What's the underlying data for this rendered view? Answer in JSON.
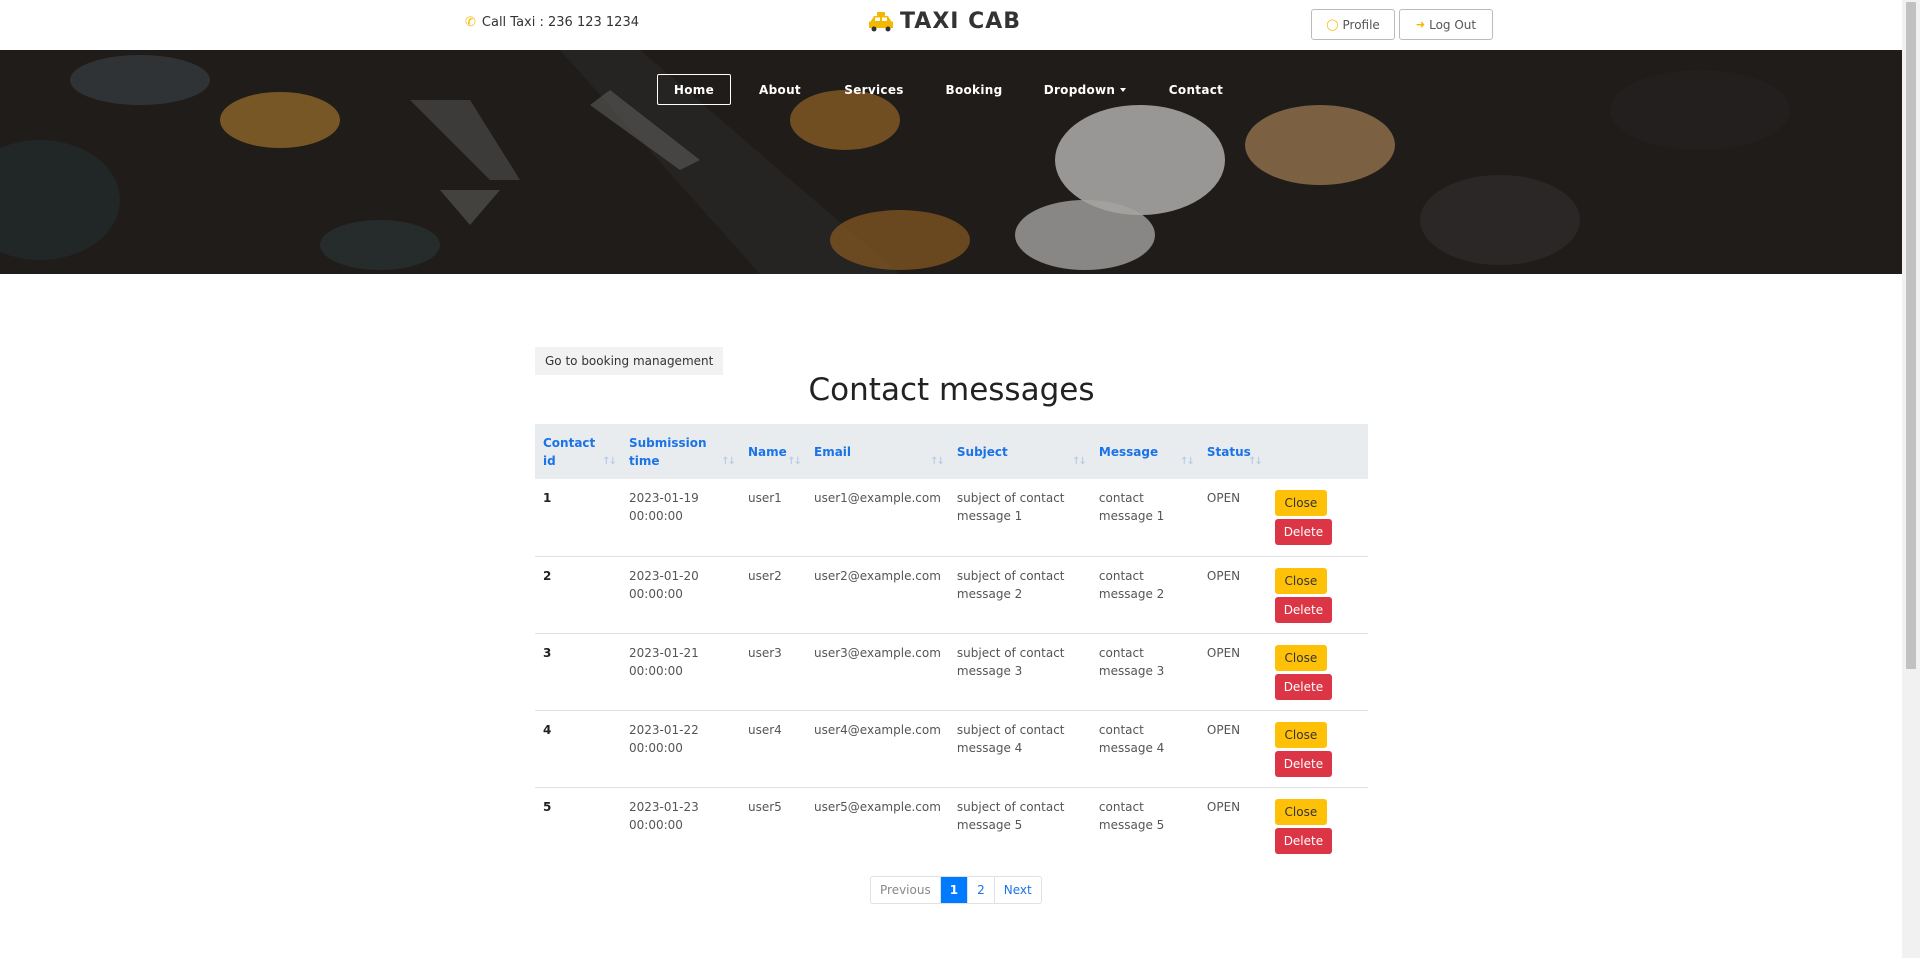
{
  "header": {
    "call_text": "Call Taxi : 236 123 1234",
    "brand": "TAXI CAB",
    "profile_label": "Profile",
    "logout_label": "Log Out",
    "accent_color": "#f5b800"
  },
  "nav": {
    "items": [
      {
        "label": "Home",
        "active": true
      },
      {
        "label": "About"
      },
      {
        "label": "Services"
      },
      {
        "label": "Booking"
      },
      {
        "label": "Dropdown"
      },
      {
        "label": "Contact"
      }
    ]
  },
  "main": {
    "go_button": "Go to booking management",
    "title": "Contact messages",
    "columns": [
      "Contact id",
      "Submission time",
      "Name",
      "Email",
      "Subject",
      "Message",
      "Status"
    ],
    "rows": [
      {
        "id": "1",
        "time": "2023-01-19 00:00:00",
        "name": "user1",
        "email": "user1@example.com",
        "subject": "subject of contact message 1",
        "message": "contact message 1",
        "status": "OPEN"
      },
      {
        "id": "2",
        "time": "2023-01-20 00:00:00",
        "name": "user2",
        "email": "user2@example.com",
        "subject": "subject of contact message 2",
        "message": "contact message 2",
        "status": "OPEN"
      },
      {
        "id": "3",
        "time": "2023-01-21 00:00:00",
        "name": "user3",
        "email": "user3@example.com",
        "subject": "subject of contact message 3",
        "message": "contact message 3",
        "status": "OPEN"
      },
      {
        "id": "4",
        "time": "2023-01-22 00:00:00",
        "name": "user4",
        "email": "user4@example.com",
        "subject": "subject of contact message 4",
        "message": "contact message 4",
        "status": "OPEN"
      },
      {
        "id": "5",
        "time": "2023-01-23 00:00:00",
        "name": "user5",
        "email": "user5@example.com",
        "subject": "subject of contact message 5",
        "message": "contact message 5",
        "status": "OPEN"
      }
    ],
    "close_label": "Close",
    "delete_label": "Delete"
  },
  "pagination": {
    "previous": "Previous",
    "pages": [
      "1",
      "2"
    ],
    "current": "1",
    "next": "Next"
  }
}
